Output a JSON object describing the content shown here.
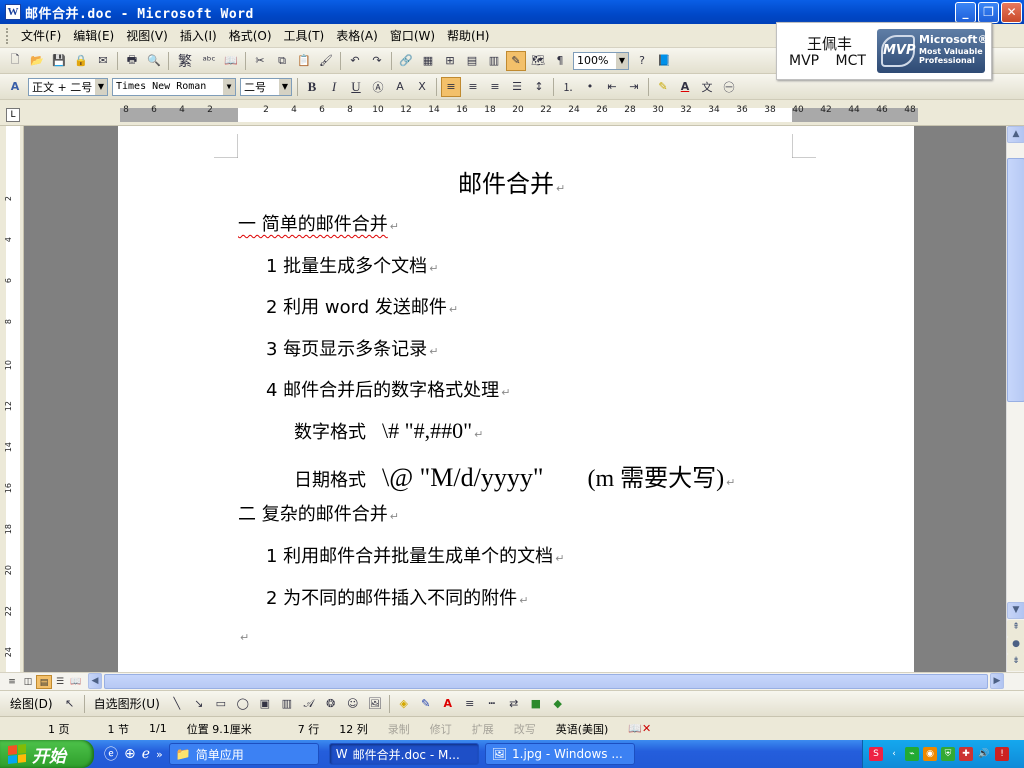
{
  "window": {
    "title": "邮件合并.doc - Microsoft Word"
  },
  "menu": [
    "文件(F)",
    "编辑(E)",
    "视图(V)",
    "插入(I)",
    "格式(O)",
    "工具(T)",
    "表格(A)",
    "窗口(W)",
    "帮助(H)"
  ],
  "toolbar": {
    "char_button": "繁",
    "zoom": "100%"
  },
  "format": {
    "style": "正文 + 二号",
    "font": "Times New Roman",
    "size": "二号",
    "bold": "B",
    "italic": "I",
    "underline": "U",
    "font_color": "A"
  },
  "mvp": {
    "name": "王佩丰",
    "roles": "MVP MCT",
    "badge_line1": "Microsoft®",
    "badge_line2": "Most Valuable Professional",
    "badge_logo": "MVP"
  },
  "ruler": {
    "h_labels": [
      "8",
      "6",
      "4",
      "2",
      "",
      "2",
      "4",
      "6",
      "8",
      "10",
      "12",
      "14",
      "16",
      "18",
      "20",
      "22",
      "24",
      "26",
      "28",
      "30",
      "32",
      "34",
      "36",
      "38",
      "40",
      "42",
      "44",
      "46",
      "48"
    ],
    "v_labels": [
      "2",
      "4",
      "6",
      "8",
      "10",
      "12",
      "14",
      "16",
      "18",
      "20",
      "22",
      "24"
    ]
  },
  "document": {
    "title": "邮件合并",
    "s1": "一  简单的邮件合并",
    "i1": "1  批量生成多个文档",
    "i2": "2  利用 word 发送邮件",
    "i3": "3  每页显示多条记录",
    "i4": "4  邮件合并后的数字格式处理",
    "f1_label": "数字格式",
    "f1_code": "\\# \"#,##0\"",
    "f2_label": "日期格式",
    "f2_code": "\\@ \"M/d/yyyy\"",
    "f2_note": "(m 需要大写)",
    "s2": "二  复杂的邮件合并",
    "j1": "1  利用邮件合并批量生成单个的文档",
    "j2": "2  为不同的邮件插入不同的附件",
    "para_mark": "↵"
  },
  "drawbar": {
    "draw": "绘图(D)",
    "autoshapes": "自选图形(U)"
  },
  "status": {
    "page": "1 页",
    "section": "1 节",
    "pages": "1/1",
    "position": "位置 9.1厘米",
    "line": "7 行",
    "col": "12 列",
    "rec": "录制",
    "trk": "修订",
    "ext": "扩展",
    "ovr": "改写",
    "lang": "英语(美国)"
  },
  "taskbar": {
    "start": "开始",
    "tasks": [
      "简单应用",
      "邮件合并.doc - M...",
      "1.jpg - Windows ..."
    ]
  },
  "colors": {
    "titlebar": "#0048c8",
    "taskbar": "#245edc",
    "start": "#2e9e2b",
    "page_bg": "#808080"
  }
}
